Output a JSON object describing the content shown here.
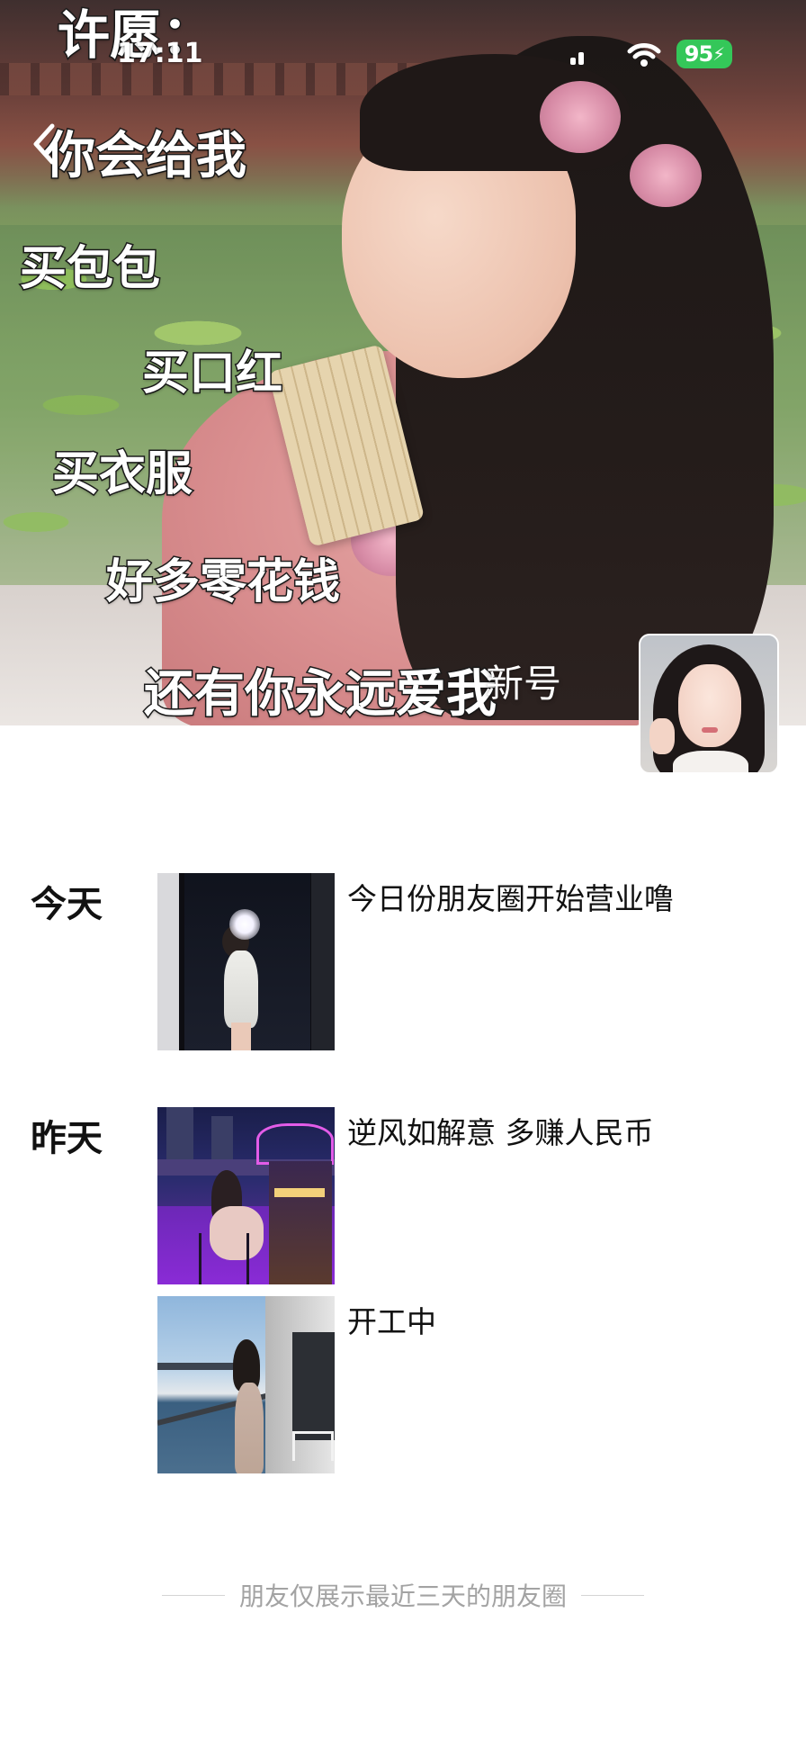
{
  "status_bar": {
    "time": "17:11",
    "battery": "95"
  },
  "cover": {
    "caption_lines": [
      "许愿：",
      "你会给我",
      "买包包",
      "买口红",
      "买衣服",
      "好多零花钱",
      "还有你永远爱我"
    ],
    "name_text": "新号"
  },
  "feed": [
    {
      "day": "今天",
      "posts": [
        {
          "text": "今日份朋友圈开始营业噜"
        }
      ]
    },
    {
      "day": "昨天",
      "posts": [
        {
          "text": "逆风如解意 多赚人民币"
        },
        {
          "text": "开工中"
        }
      ]
    }
  ],
  "footer": {
    "text": "朋友仅展示最近三天的朋友圈"
  },
  "icons": [
    "back-chevron-icon",
    "cellular-signal-icon",
    "wifi-icon",
    "battery-charging-icon"
  ],
  "colors": {
    "battery": "#34c759",
    "footer_text": "#a3a3a3"
  }
}
